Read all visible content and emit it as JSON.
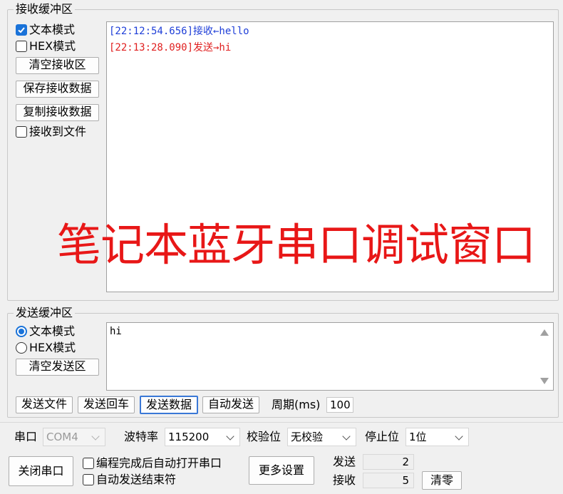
{
  "receive": {
    "legend": "接收缓冲区",
    "text_mode_label": "文本模式",
    "text_mode_checked": true,
    "hex_mode_label": "HEX模式",
    "hex_mode_checked": false,
    "clear_label": "清空接收区",
    "save_label": "保存接收数据",
    "copy_label": "复制接收数据",
    "to_file_label": "接收到文件",
    "to_file_checked": false,
    "lines": [
      {
        "text": "[22:12:54.656]接收←hello",
        "color": "#1f3fd8"
      },
      {
        "text": "[22:13:28.090]发送→hi",
        "color": "#e02020"
      }
    ]
  },
  "watermark": {
    "text": "笔记本蓝牙串口调试窗口",
    "color": "#e81717"
  },
  "send": {
    "legend": "发送缓冲区",
    "text_mode_label": "文本模式",
    "text_mode_checked": true,
    "hex_mode_label": "HEX模式",
    "hex_mode_checked": false,
    "clear_label": "清空发送区",
    "content": "hi"
  },
  "actions": {
    "send_file": "发送文件",
    "send_enter": "发送回车",
    "send_data": "发送数据",
    "auto_send": "自动发送",
    "period_label": "周期(ms)",
    "period_value": "100"
  },
  "settings": {
    "port_label": "串口",
    "port_value": "COM4",
    "baud_label": "波特率",
    "baud_value": "115200",
    "parity_label": "校验位",
    "parity_value": "无校验",
    "stop_label": "停止位",
    "stop_value": "1位"
  },
  "bottom": {
    "close_port": "关闭串口",
    "auto_open_label": "编程完成后自动打开串口",
    "auto_open_checked": false,
    "auto_end_label": "自动发送结束符",
    "auto_end_checked": false,
    "more_settings": "更多设置",
    "sent_label": "发送",
    "sent_count": "2",
    "recv_label": "接收",
    "recv_count": "5",
    "clear_counts": "清零"
  }
}
